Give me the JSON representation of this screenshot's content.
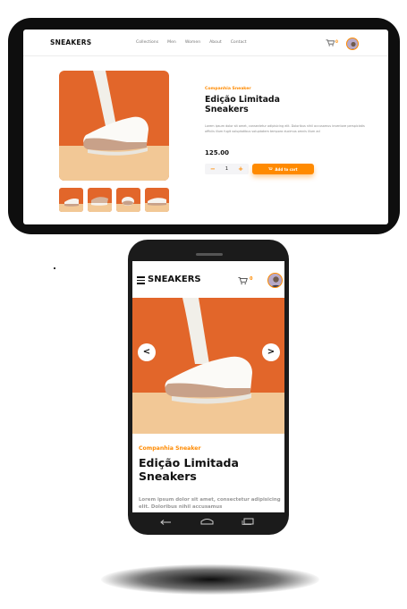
{
  "desktop": {
    "logo": "SNEAKERS",
    "nav": [
      "Collections",
      "Men",
      "Women",
      "About",
      "Contact"
    ],
    "cart_count": "0",
    "company": "Companhia Sneaker",
    "title": "Edição Limitada Sneakers",
    "description": "Lorem ipsum dolor sit amet, consectetur adipisicing elit. Doloribus nihil accusamus inventore perspiciatis officiis illum fugit voluptatibus voluptatem tempora ducimus omnis illum ad",
    "price": "125.00",
    "quantity": "1",
    "minus": "−",
    "plus": "+",
    "add_to_cart": "Add to cart"
  },
  "mobile": {
    "logo": "SNEAKERS",
    "cart_count": "0",
    "prev": "<",
    "next": ">",
    "company": "Companhia Sneaker",
    "title": "Edição Limitada Sneakers",
    "description": "Lorem ipsum dolor sit amet, consectetur adipisicing elit. Doloribus nihil accusamus"
  },
  "colors": {
    "accent": "#ff8a00",
    "hero_orange": "#e2662a",
    "floor": "#f2c896",
    "device": "#0e0e0e"
  },
  "icons": [
    "cart-icon",
    "menu-icon",
    "back-icon",
    "home-icon",
    "recents-icon",
    "plus-icon",
    "minus-icon"
  ]
}
